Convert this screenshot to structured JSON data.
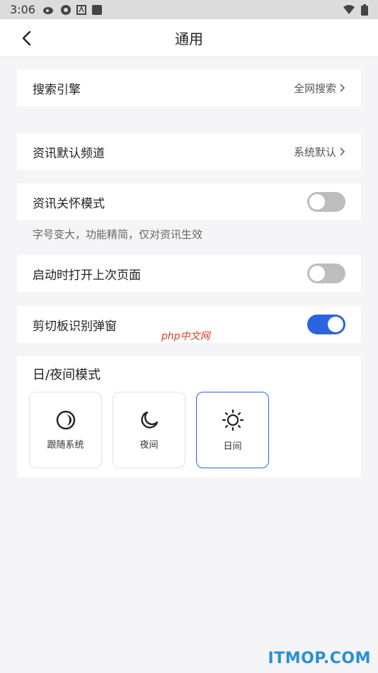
{
  "status_bar": {
    "time": "3:06"
  },
  "header": {
    "title": "通用"
  },
  "search_engine": {
    "label": "搜索引擎",
    "value": "全网搜索"
  },
  "news_channel": {
    "label": "资讯默认频道",
    "value": "系统默认"
  },
  "care_mode": {
    "label": "资讯关怀模式",
    "enabled": false,
    "hint": "字号变大，功能精简，仅对资讯生效"
  },
  "restore_last_page": {
    "label": "启动时打开上次页面",
    "enabled": false
  },
  "clipboard_popup": {
    "label": "剪切板识别弹窗",
    "enabled": true
  },
  "theme_mode": {
    "title": "日/夜间模式",
    "options": [
      {
        "label": "跟随系统",
        "icon": "follow-system-icon",
        "selected": false
      },
      {
        "label": "夜间",
        "icon": "moon-icon",
        "selected": false
      },
      {
        "label": "日间",
        "icon": "sun-icon",
        "selected": true
      }
    ]
  },
  "watermarks": {
    "php": "php中文网",
    "site": "ITMOP.COM"
  },
  "colors": {
    "accent": "#2b63e0",
    "toggle_off": "#bdbdbd",
    "background": "#f5f5f7"
  }
}
